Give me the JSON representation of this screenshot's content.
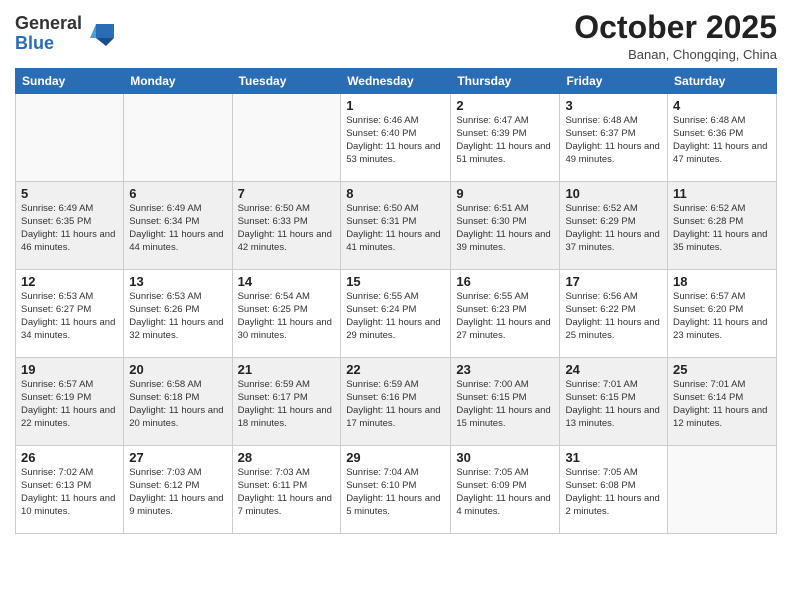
{
  "header": {
    "logo_general": "General",
    "logo_blue": "Blue",
    "month": "October 2025",
    "location": "Banan, Chongqing, China"
  },
  "days_of_week": [
    "Sunday",
    "Monday",
    "Tuesday",
    "Wednesday",
    "Thursday",
    "Friday",
    "Saturday"
  ],
  "weeks": [
    [
      {
        "day": "",
        "info": ""
      },
      {
        "day": "",
        "info": ""
      },
      {
        "day": "",
        "info": ""
      },
      {
        "day": "1",
        "info": "Sunrise: 6:46 AM\nSunset: 6:40 PM\nDaylight: 11 hours and 53 minutes."
      },
      {
        "day": "2",
        "info": "Sunrise: 6:47 AM\nSunset: 6:39 PM\nDaylight: 11 hours and 51 minutes."
      },
      {
        "day": "3",
        "info": "Sunrise: 6:48 AM\nSunset: 6:37 PM\nDaylight: 11 hours and 49 minutes."
      },
      {
        "day": "4",
        "info": "Sunrise: 6:48 AM\nSunset: 6:36 PM\nDaylight: 11 hours and 47 minutes."
      }
    ],
    [
      {
        "day": "5",
        "info": "Sunrise: 6:49 AM\nSunset: 6:35 PM\nDaylight: 11 hours and 46 minutes."
      },
      {
        "day": "6",
        "info": "Sunrise: 6:49 AM\nSunset: 6:34 PM\nDaylight: 11 hours and 44 minutes."
      },
      {
        "day": "7",
        "info": "Sunrise: 6:50 AM\nSunset: 6:33 PM\nDaylight: 11 hours and 42 minutes."
      },
      {
        "day": "8",
        "info": "Sunrise: 6:50 AM\nSunset: 6:31 PM\nDaylight: 11 hours and 41 minutes."
      },
      {
        "day": "9",
        "info": "Sunrise: 6:51 AM\nSunset: 6:30 PM\nDaylight: 11 hours and 39 minutes."
      },
      {
        "day": "10",
        "info": "Sunrise: 6:52 AM\nSunset: 6:29 PM\nDaylight: 11 hours and 37 minutes."
      },
      {
        "day": "11",
        "info": "Sunrise: 6:52 AM\nSunset: 6:28 PM\nDaylight: 11 hours and 35 minutes."
      }
    ],
    [
      {
        "day": "12",
        "info": "Sunrise: 6:53 AM\nSunset: 6:27 PM\nDaylight: 11 hours and 34 minutes."
      },
      {
        "day": "13",
        "info": "Sunrise: 6:53 AM\nSunset: 6:26 PM\nDaylight: 11 hours and 32 minutes."
      },
      {
        "day": "14",
        "info": "Sunrise: 6:54 AM\nSunset: 6:25 PM\nDaylight: 11 hours and 30 minutes."
      },
      {
        "day": "15",
        "info": "Sunrise: 6:55 AM\nSunset: 6:24 PM\nDaylight: 11 hours and 29 minutes."
      },
      {
        "day": "16",
        "info": "Sunrise: 6:55 AM\nSunset: 6:23 PM\nDaylight: 11 hours and 27 minutes."
      },
      {
        "day": "17",
        "info": "Sunrise: 6:56 AM\nSunset: 6:22 PM\nDaylight: 11 hours and 25 minutes."
      },
      {
        "day": "18",
        "info": "Sunrise: 6:57 AM\nSunset: 6:20 PM\nDaylight: 11 hours and 23 minutes."
      }
    ],
    [
      {
        "day": "19",
        "info": "Sunrise: 6:57 AM\nSunset: 6:19 PM\nDaylight: 11 hours and 22 minutes."
      },
      {
        "day": "20",
        "info": "Sunrise: 6:58 AM\nSunset: 6:18 PM\nDaylight: 11 hours and 20 minutes."
      },
      {
        "day": "21",
        "info": "Sunrise: 6:59 AM\nSunset: 6:17 PM\nDaylight: 11 hours and 18 minutes."
      },
      {
        "day": "22",
        "info": "Sunrise: 6:59 AM\nSunset: 6:16 PM\nDaylight: 11 hours and 17 minutes."
      },
      {
        "day": "23",
        "info": "Sunrise: 7:00 AM\nSunset: 6:15 PM\nDaylight: 11 hours and 15 minutes."
      },
      {
        "day": "24",
        "info": "Sunrise: 7:01 AM\nSunset: 6:15 PM\nDaylight: 11 hours and 13 minutes."
      },
      {
        "day": "25",
        "info": "Sunrise: 7:01 AM\nSunset: 6:14 PM\nDaylight: 11 hours and 12 minutes."
      }
    ],
    [
      {
        "day": "26",
        "info": "Sunrise: 7:02 AM\nSunset: 6:13 PM\nDaylight: 11 hours and 10 minutes."
      },
      {
        "day": "27",
        "info": "Sunrise: 7:03 AM\nSunset: 6:12 PM\nDaylight: 11 hours and 9 minutes."
      },
      {
        "day": "28",
        "info": "Sunrise: 7:03 AM\nSunset: 6:11 PM\nDaylight: 11 hours and 7 minutes."
      },
      {
        "day": "29",
        "info": "Sunrise: 7:04 AM\nSunset: 6:10 PM\nDaylight: 11 hours and 5 minutes."
      },
      {
        "day": "30",
        "info": "Sunrise: 7:05 AM\nSunset: 6:09 PM\nDaylight: 11 hours and 4 minutes."
      },
      {
        "day": "31",
        "info": "Sunrise: 7:05 AM\nSunset: 6:08 PM\nDaylight: 11 hours and 2 minutes."
      },
      {
        "day": "",
        "info": ""
      }
    ]
  ]
}
